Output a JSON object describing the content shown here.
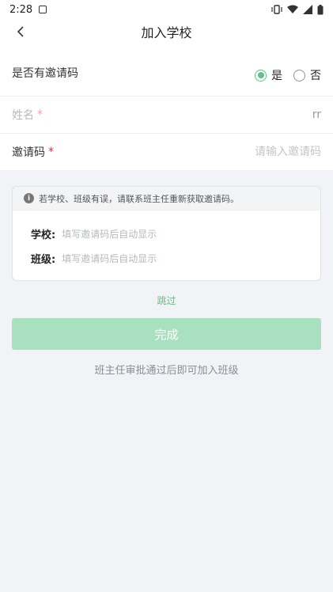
{
  "status_bar": {
    "time": "2:28",
    "icons": [
      "notification-icon",
      "vibrate-icon",
      "wifi-icon",
      "signal-icon",
      "battery-icon"
    ]
  },
  "nav": {
    "title": "加入学校",
    "back_icon": "chevron-left-icon"
  },
  "form": {
    "invite_question": "是否有邀请码",
    "options": [
      {
        "label": "是",
        "checked": true
      },
      {
        "label": "否",
        "checked": false
      }
    ],
    "name_label": "姓名",
    "name_value": "rr",
    "code_label": "邀请码",
    "code_placeholder": "请输入邀请码",
    "required_mark": "*"
  },
  "info": {
    "notice": "若学校、班级有误，请联系班主任重新获取邀请码。",
    "school_label": "学校:",
    "school_value": "填写邀请码后自动显示",
    "class_label": "班级:",
    "class_value": "填写邀请码后自动显示"
  },
  "actions": {
    "skip": "跳过",
    "done": "完成"
  },
  "hint": "班主任审批通过后即可加入班级",
  "colors": {
    "accent": "#5cc487",
    "button_disabled": "#a8e0c0",
    "background": "#f2f3f7",
    "required": "#e0303d"
  }
}
